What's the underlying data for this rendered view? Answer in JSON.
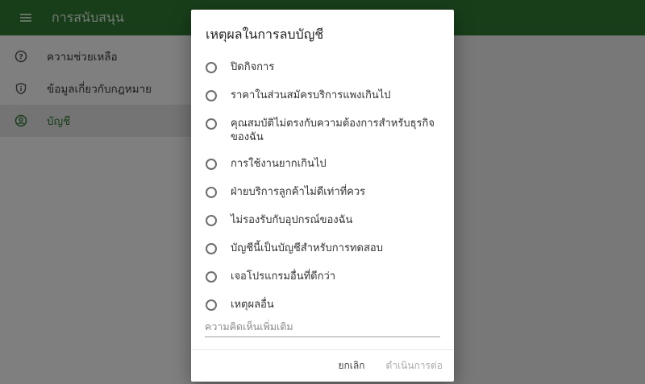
{
  "appbar": {
    "title": "การสนับสนุน",
    "menu_icon": "hamburger-icon"
  },
  "sidebar": {
    "items": [
      {
        "label": "ความช่วยเหลือ",
        "icon": "help-circle-icon"
      },
      {
        "label": "ข้อมูลเกี่ยวกับกฎหมาย",
        "icon": "shield-info-icon"
      },
      {
        "label": "บัญชี",
        "icon": "account-circle-icon",
        "active": true
      }
    ]
  },
  "dialog": {
    "title": "เหตุผลในการลบบัญชี",
    "options": [
      "ปิดกิจการ",
      "ราคาในส่วนสมัครบริการแพงเกินไป",
      "คุณสมบัติไม่ตรงกับความต้องการสำหรับธุรกิจของฉัน",
      "การใช้งานยากเกินไป",
      "ฝ่ายบริการลูกค้าไม่ดีเท่าที่ควร",
      "ไม่รองรับกับอุปกรณ์ของฉัน",
      "บัญชีนี้เป็นบัญชีสำหรับการทดสอบ",
      "เจอโปรแกรมอื่นที่ดีกว่า",
      "เหตุผลอื่น"
    ],
    "comment_placeholder": "ความคิดเห็นเพิ่มเติม",
    "cancel_label": "ยกเลิก",
    "proceed_label": "ดำเนินการต่อ"
  },
  "colors": {
    "primary": "#2e7d32",
    "scrim": "rgba(0,0,0,0.5)"
  }
}
